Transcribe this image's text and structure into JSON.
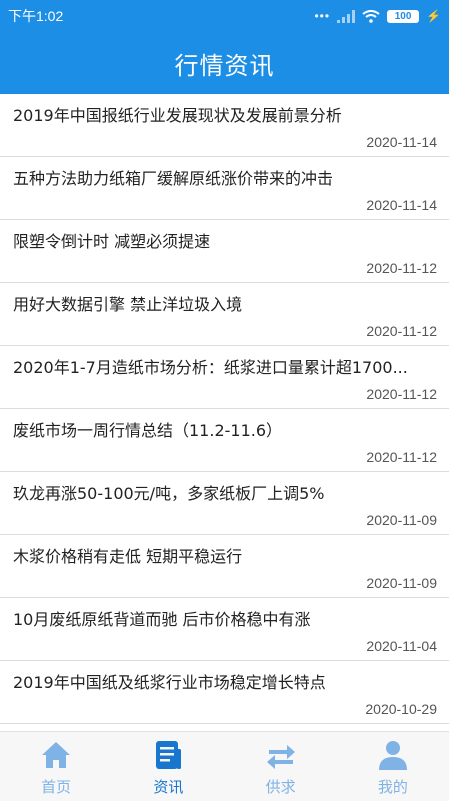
{
  "status": {
    "time": "下午1:02",
    "battery": "100"
  },
  "header": {
    "title": "行情资讯"
  },
  "news": [
    {
      "title": "2019年中国报纸行业发展现状及发展前景分析",
      "date": "2020-11-14"
    },
    {
      "title": "五种方法助力纸箱厂缓解原纸涨价带来的冲击",
      "date": "2020-11-14"
    },
    {
      "title": "限塑令倒计时 减塑必须提速",
      "date": "2020-11-12"
    },
    {
      "title": "用好大数据引擎 禁止洋垃圾入境",
      "date": "2020-11-12"
    },
    {
      "title": "2020年1-7月造纸市场分析：纸浆进口量累计超1700...",
      "date": "2020-11-12"
    },
    {
      "title": "废纸市场一周行情总结（11.2-11.6）",
      "date": "2020-11-12"
    },
    {
      "title": "玖龙再涨50-100元/吨，多家纸板厂上调5%",
      "date": "2020-11-09"
    },
    {
      "title": "木浆价格稍有走低 短期平稳运行",
      "date": "2020-11-09"
    },
    {
      "title": "10月废纸原纸背道而驰 后市价格稳中有涨",
      "date": "2020-11-04"
    },
    {
      "title": "2019年中国纸及纸浆行业市场稳定增长特点",
      "date": "2020-10-29"
    }
  ],
  "tabs": [
    {
      "label": "首页",
      "icon": "home-icon"
    },
    {
      "label": "资讯",
      "icon": "news-icon"
    },
    {
      "label": "供求",
      "icon": "exchange-icon"
    },
    {
      "label": "我的",
      "icon": "user-icon"
    }
  ],
  "colors": {
    "primary": "#1d8ee6",
    "tab_active": "#1876cf",
    "tab_inactive": "#7fb3e6"
  }
}
